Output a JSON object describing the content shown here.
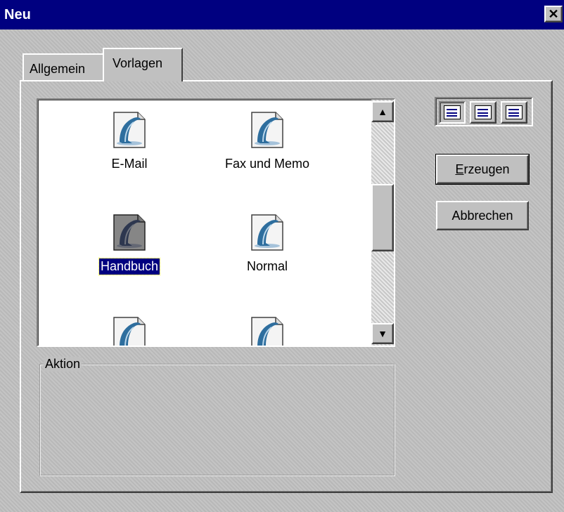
{
  "window": {
    "title": "Neu",
    "close_glyph": "✕"
  },
  "tabs": [
    {
      "label": "Allgemein",
      "active": false
    },
    {
      "label": "Vorlagen",
      "active": true
    }
  ],
  "templates": {
    "items": [
      {
        "label": "E-Mail",
        "icon": "dolphin-document-icon",
        "selected": false
      },
      {
        "label": "Fax und Memo",
        "icon": "dolphin-document-icon",
        "selected": false
      },
      {
        "label": "Handbuch",
        "icon": "dolphin-document-icon",
        "selected": true
      },
      {
        "label": "Normal",
        "icon": "dolphin-document-icon",
        "selected": false
      },
      {
        "label": "",
        "icon": "dolphin-document-icon",
        "selected": false
      },
      {
        "label": "",
        "icon": "dolphin-document-icon",
        "selected": false
      }
    ]
  },
  "scrollbar": {
    "up_glyph": "▲",
    "down_glyph": "▼"
  },
  "view_buttons": [
    {
      "icon": "large-icons-view-icon",
      "pressed": true
    },
    {
      "icon": "list-view-icon",
      "pressed": false
    },
    {
      "icon": "details-view-icon",
      "pressed": false
    }
  ],
  "buttons": {
    "create": {
      "accel": "E",
      "rest": "rzeugen"
    },
    "cancel": "Abbrechen"
  },
  "action_group": {
    "label": "Aktion"
  },
  "colors": {
    "titlebar": "#000080",
    "face": "#c0c0c0",
    "selection": "#000080"
  }
}
